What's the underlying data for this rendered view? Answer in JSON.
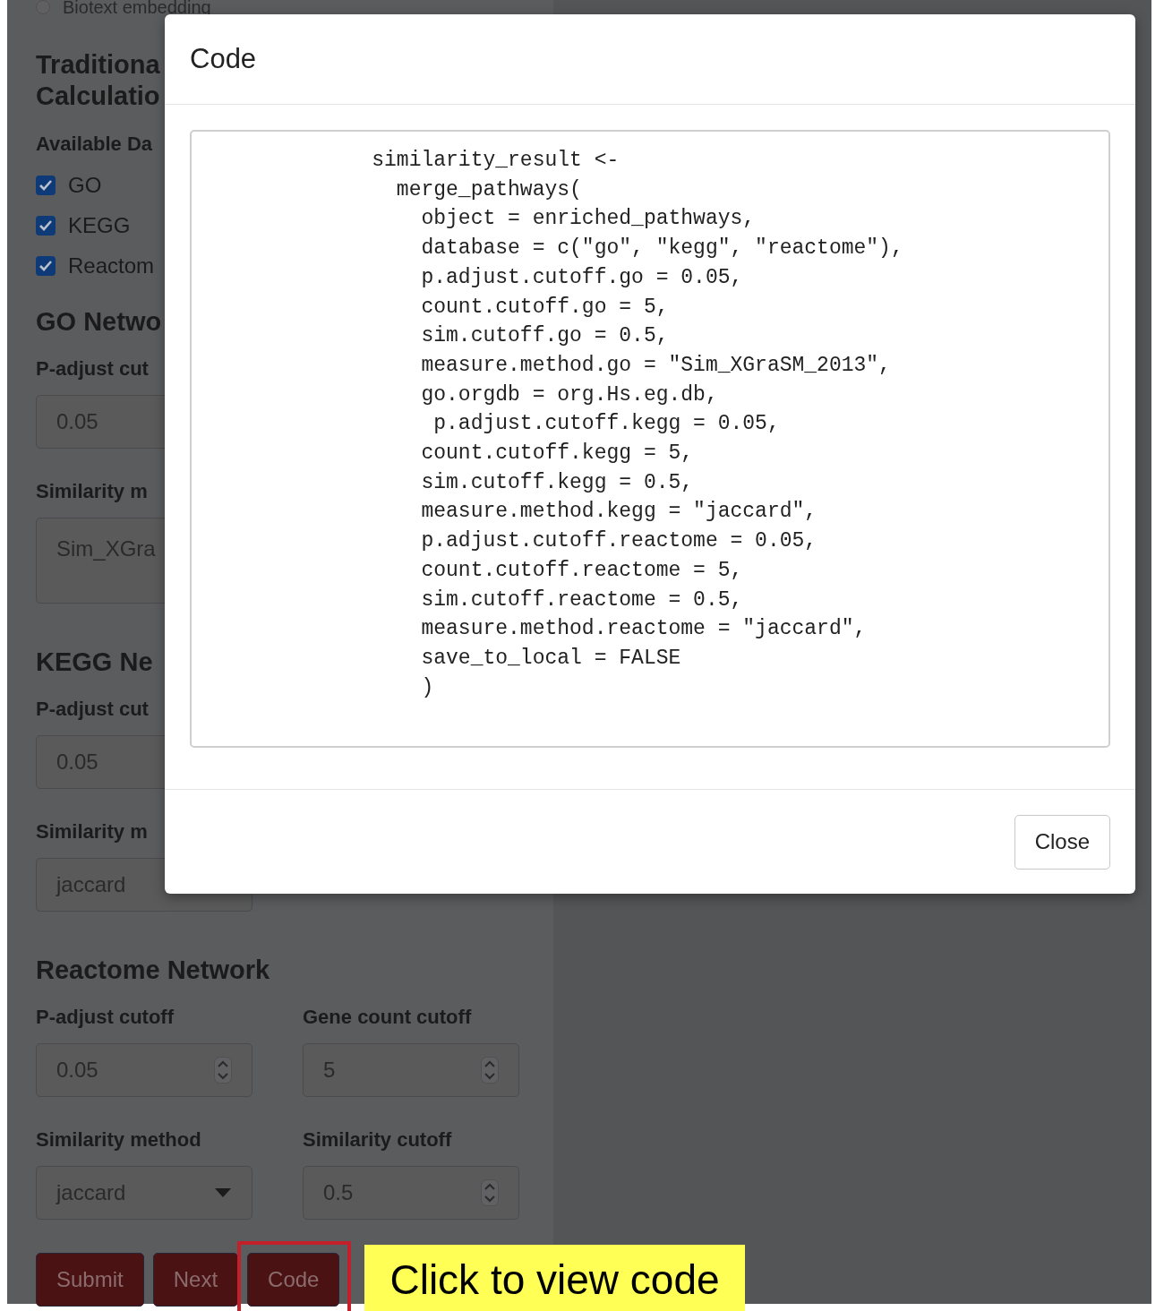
{
  "sidebar": {
    "radio": {
      "label": "Biotext embedding",
      "selected": false
    },
    "title_lines": [
      "Traditiona",
      "Calculatio"
    ],
    "databases": {
      "label": "Available Da",
      "items": [
        {
          "label": "GO",
          "checked": true
        },
        {
          "label": "KEGG",
          "checked": true
        },
        {
          "label": "Reactom",
          "checked": true
        }
      ]
    },
    "networks": [
      {
        "title": "GO Netwo",
        "rows": [
          [
            {
              "kind": "number",
              "label": "P-adjust cut",
              "value": "0.05"
            }
          ],
          [
            {
              "kind": "multiselect",
              "label": "Similarity m",
              "value": "Sim_XGra"
            }
          ]
        ]
      },
      {
        "title": "KEGG Ne",
        "rows": [
          [
            {
              "kind": "number",
              "label": "P-adjust cut",
              "value": "0.05"
            }
          ],
          [
            {
              "kind": "select",
              "label": "Similarity m",
              "value": "jaccard"
            }
          ]
        ]
      },
      {
        "title": "Reactome Network",
        "rows": [
          [
            {
              "kind": "number",
              "label": "P-adjust cutoff",
              "value": "0.05"
            },
            {
              "kind": "number",
              "label": "Gene count cutoff",
              "value": "5"
            }
          ],
          [
            {
              "kind": "select",
              "label": "Similarity method",
              "value": "jaccard"
            },
            {
              "kind": "number",
              "label": "Similarity cutoff",
              "value": "0.5"
            }
          ]
        ]
      }
    ],
    "buttons": [
      {
        "label": "Submit",
        "highlighted": false
      },
      {
        "label": "Next",
        "highlighted": false
      },
      {
        "label": "Code",
        "highlighted": true
      }
    ],
    "callout": "Click to view code"
  },
  "modal": {
    "title": "Code",
    "code": "              similarity_result <-\n                merge_pathways(\n                  object = enriched_pathways,\n                  database = c(\"go\", \"kegg\", \"reactome\"),\n                  p.adjust.cutoff.go = 0.05,\n                  count.cutoff.go = 5,\n                  sim.cutoff.go = 0.5,\n                  measure.method.go = \"Sim_XGraSM_2013\",\n                  go.orgdb = org.Hs.eg.db,\n                   p.adjust.cutoff.kegg = 0.05,\n                  count.cutoff.kegg = 5,\n                  sim.cutoff.kegg = 0.5,\n                  measure.method.kegg = \"jaccard\",\n                  p.adjust.cutoff.reactome = 0.05,\n                  count.cutoff.reactome = 5,\n                  sim.cutoff.reactome = 0.5,\n                  measure.method.reactome = \"jaccard\",\n                  save_to_local = FALSE\n                  )",
    "close_button": "Close"
  }
}
